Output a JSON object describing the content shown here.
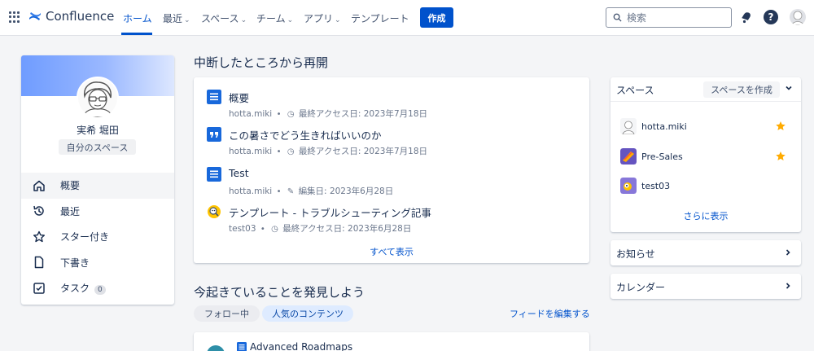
{
  "topnav": {
    "brand": "Confluence",
    "items": [
      {
        "label": "ホーム",
        "has_dropdown": false
      },
      {
        "label": "最近",
        "has_dropdown": true
      },
      {
        "label": "スペース",
        "has_dropdown": true
      },
      {
        "label": "チーム",
        "has_dropdown": true
      },
      {
        "label": "アプリ",
        "has_dropdown": true
      },
      {
        "label": "テンプレート",
        "has_dropdown": false
      }
    ],
    "create_label": "作成",
    "search_placeholder": "検索",
    "help_glyph": "?",
    "accent": "#0052cc"
  },
  "profile": {
    "name": "実希 堀田",
    "space_button": "自分のスペース",
    "nav": [
      {
        "label": "概要",
        "icon": "home-icon"
      },
      {
        "label": "最近",
        "icon": "history-icon"
      },
      {
        "label": "スター付き",
        "icon": "star-outline-icon"
      },
      {
        "label": "下書き",
        "icon": "draft-icon"
      },
      {
        "label": "タスク",
        "icon": "task-icon",
        "badge": "0"
      }
    ]
  },
  "resume": {
    "title": "中断したところから再開",
    "items": [
      {
        "title": "概要",
        "space": "hotta.miki",
        "sep": "•",
        "action_icon": "clock-icon",
        "meta": "最終アクセス日: 2023年7月18日",
        "icon": "page-icon"
      },
      {
        "title": "この暑さでどう生きればいいのか",
        "space": "hotta.miki",
        "sep": "•",
        "action_icon": "clock-icon",
        "meta": "最終アクセス日: 2023年7月18日",
        "icon": "quote-icon"
      },
      {
        "title": "Test",
        "space": "hotta.miki",
        "sep": "•",
        "action_icon": "pencil-icon",
        "meta": "編集日: 2023年6月28日",
        "icon": "page-icon"
      },
      {
        "title": "テンプレート - トラブルシューティング記事",
        "space": "test03",
        "sep": "•",
        "action_icon": "clock-icon",
        "meta": "最終アクセス日: 2023年6月28日",
        "icon": "magnifier-face-icon"
      }
    ],
    "show_all": "すべて表示"
  },
  "discover": {
    "title": "今起きていることを発見しよう",
    "tabs": [
      "フォロー中",
      "人気のコンテンツ"
    ],
    "edit_feed": "フィードを編集する",
    "feed_item_title": "Advanced Roadmaps"
  },
  "spaces": {
    "title": "スペース",
    "create_button": "スペースを作成",
    "items": [
      {
        "name": "hotta.miki",
        "starred": true
      },
      {
        "name": "Pre-Sales",
        "starred": true
      },
      {
        "name": "test03",
        "starred": false
      }
    ],
    "show_more": "さらに表示"
  },
  "panels": {
    "announcements": "お知らせ",
    "calendar": "カレンダー"
  }
}
